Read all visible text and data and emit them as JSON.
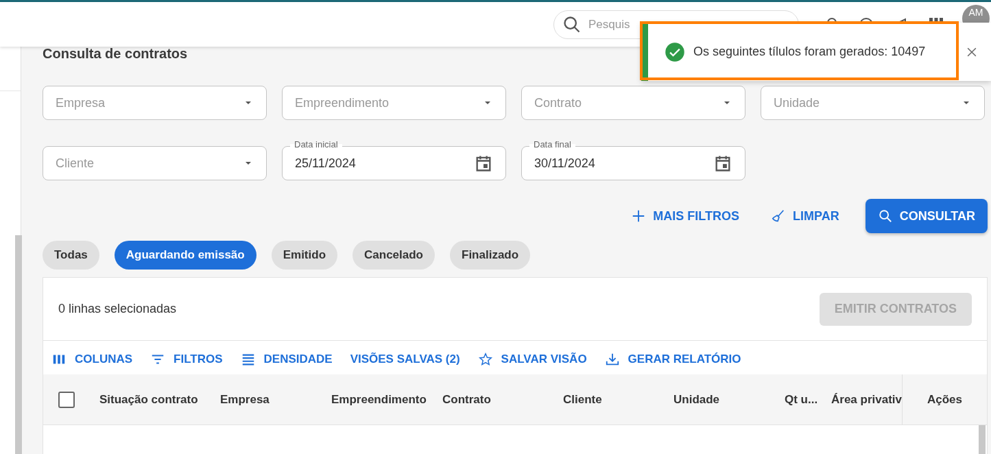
{
  "header": {
    "search": {
      "placeholder": "Pesquis"
    },
    "avatar": "AM"
  },
  "toast": {
    "kind": "success",
    "message": "Os seguintes tílulos foram gerados: 10497",
    "highlighted": true
  },
  "page": {
    "title": "Consulta de contratos"
  },
  "filters": [
    {
      "kind": "select",
      "placeholder": "Empresa"
    },
    {
      "kind": "select",
      "placeholder": "Empreendimento"
    },
    {
      "kind": "select",
      "placeholder": "Contrato"
    },
    {
      "kind": "select",
      "placeholder": "Unidade"
    },
    {
      "kind": "select",
      "placeholder": "Cliente"
    },
    {
      "kind": "date",
      "label": "Data inicial",
      "value": "25/11/2024"
    },
    {
      "kind": "date",
      "label": "Data final",
      "value": "30/11/2024"
    }
  ],
  "actions": [
    {
      "kind": "add",
      "label": "MAIS FILTROS"
    },
    {
      "kind": "clear",
      "label": "LIMPAR"
    },
    {
      "kind": "search",
      "label": "CONSULTAR"
    }
  ],
  "status_chips": [
    {
      "label": "Todas",
      "selected": false
    },
    {
      "label": "Aguardando emissão",
      "selected": true
    },
    {
      "label": "Emitido",
      "selected": false
    },
    {
      "label": "Cancelado",
      "selected": false
    },
    {
      "label": "Finalizado",
      "selected": false
    }
  ],
  "table": {
    "selection_text": "0 linhas selecionadas",
    "emit_button": {
      "label": "EMITIR CONTRATOS",
      "disabled": true
    },
    "toolbar": [
      {
        "kind": "columns",
        "label": "COLUNAS"
      },
      {
        "kind": "filter",
        "label": "FILTROS"
      },
      {
        "kind": "density",
        "label": "DENSIDADE"
      },
      {
        "kind": "views",
        "label": "VISÕES SALVAS (2)"
      },
      {
        "kind": "star",
        "label": "SALVAR VISÃO"
      },
      {
        "kind": "export",
        "label": "GERAR RELATÓRIO"
      }
    ],
    "select_all_checked": false,
    "columns": [
      "Situação contrato",
      "Empresa",
      "Empreendimento",
      "Contrato",
      "Cliente",
      "Unidade",
      "Qt u...",
      "Área privativ"
    ],
    "actions_column": "Ações"
  }
}
